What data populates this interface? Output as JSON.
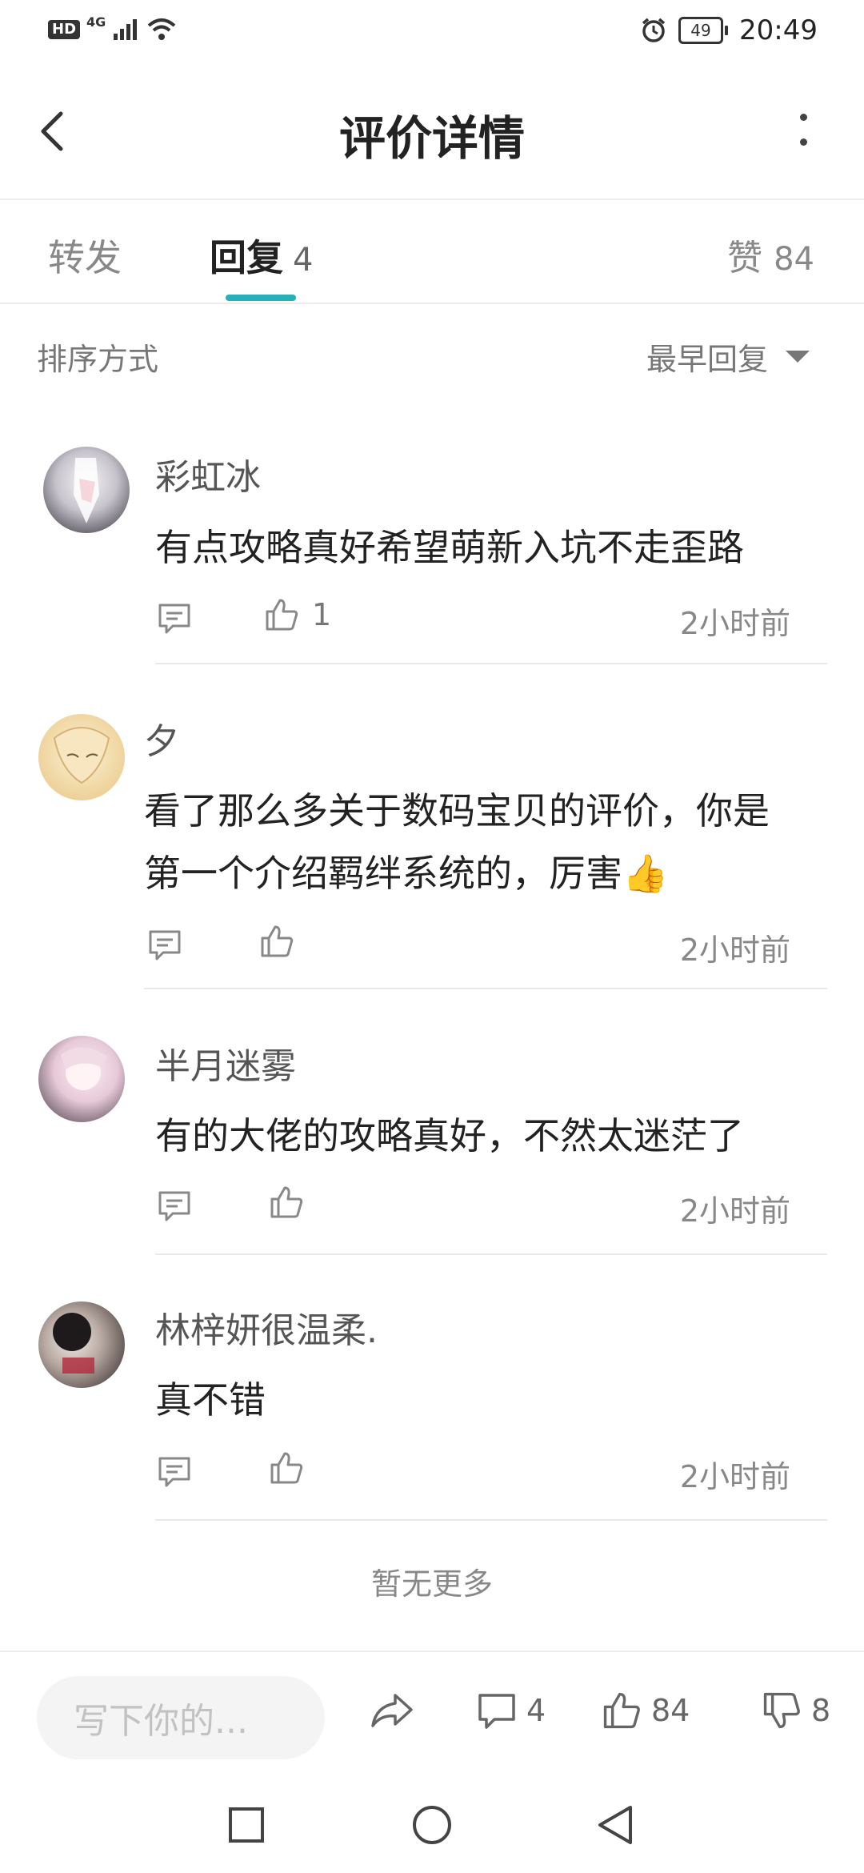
{
  "status_bar": {
    "network": "4G",
    "hd": "HD",
    "battery": "49",
    "time": "20:49"
  },
  "header": {
    "title": "评价详情"
  },
  "tabs": {
    "forward": "转发",
    "reply": "回复",
    "reply_count": "4",
    "like": "赞",
    "like_count": "84"
  },
  "sort": {
    "label": "排序方式",
    "selected": "最早回复"
  },
  "comments": [
    {
      "user": "彩虹冰",
      "text": "有点攻略真好希望萌新入坑不走歪路",
      "likes": "1",
      "time": "2小时前"
    },
    {
      "user": "夕",
      "text_line1": "看了那么多关于数码宝贝的评价，你是",
      "text_line2": "第一个介绍羁绊系统的，厉害👍",
      "likes": "",
      "time": "2小时前"
    },
    {
      "user": "半月迷雾",
      "text": "有的大佬的攻略真好，不然太迷茫了",
      "likes": "",
      "time": "2小时前"
    },
    {
      "user": "林梓妍很温柔.",
      "text": "真不错",
      "likes": "",
      "time": "2小时前"
    }
  ],
  "no_more": "暂无更多",
  "bottom_bar": {
    "input_placeholder": "写下你的...",
    "comment_count": "4",
    "like_count": "84",
    "dislike_count": "8"
  },
  "colors": {
    "accent": "#26b0b7",
    "divider": "#e8e8e8",
    "muted_text": "#888888"
  }
}
